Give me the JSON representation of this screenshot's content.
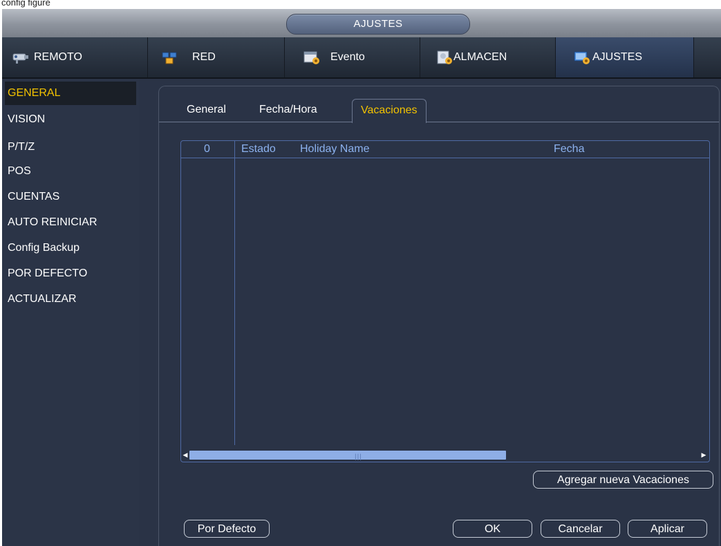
{
  "caption": "config figure",
  "window_title": "AJUSTES",
  "nav_tabs": [
    {
      "label": "REMOTO",
      "icon": "camera-icon"
    },
    {
      "label": "RED",
      "icon": "network-icon"
    },
    {
      "label": "Evento",
      "icon": "event-icon"
    },
    {
      "label": "ALMACEN",
      "icon": "storage-icon"
    },
    {
      "label": "AJUSTES",
      "icon": "settings-icon",
      "active": true
    }
  ],
  "sidebar": {
    "items": [
      {
        "label": "GENERAL",
        "active": true
      },
      {
        "label": "VISION"
      },
      {
        "label": "P/T/Z"
      },
      {
        "label": "POS"
      },
      {
        "label": "CUENTAS"
      },
      {
        "label": "AUTO REINICIAR"
      },
      {
        "label": "Config Backup"
      },
      {
        "label": "POR DEFECTO"
      },
      {
        "label": "ACTUALIZAR"
      }
    ]
  },
  "subtabs": [
    {
      "label": "General"
    },
    {
      "label": "Fecha/Hora"
    },
    {
      "label": "Vacaciones",
      "active": true
    }
  ],
  "table": {
    "columns": [
      "0",
      "Estado",
      "Holiday Name",
      "Fecha"
    ],
    "rows": []
  },
  "buttons": {
    "add_holiday": "Agregar nueva Vacaciones",
    "default": "Por Defecto",
    "ok": "OK",
    "cancel": "Cancelar",
    "apply": "Aplicar"
  },
  "colors": {
    "accent": "#f2c200",
    "header_text": "#8cb2ef",
    "panel_bg": "#2a3346"
  }
}
